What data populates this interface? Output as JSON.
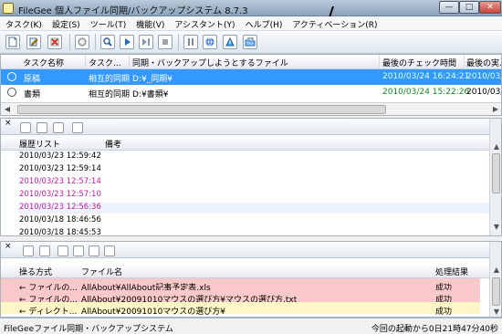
{
  "window": {
    "title": "FileGee 個人ファイル同期/バックアップシステム 8.7.3",
    "minimize": "—",
    "maximize": "□",
    "close": "✕"
  },
  "menu": [
    "タスク(K)",
    "設定(S)",
    "ツール(T)",
    "機能(V)",
    "アシスタント(Y)",
    "ヘルプ(H)",
    "アクティベーション(R)"
  ],
  "toolbar": {
    "icons": [
      "new-task-icon",
      "edit-task-icon",
      "delete-task-icon",
      "settings-icon",
      "search-icon",
      "run-icon",
      "step-icon",
      "stop-icon",
      "pause-icon",
      "web-icon",
      "update-icon",
      "folder-sync-icon"
    ]
  },
  "tasks": {
    "columns": [
      "タスク名称",
      "タスク...",
      "同期・バックアップしようとするファイル",
      "最後のチェック時間",
      "最後の実..."
    ],
    "rows": [
      {
        "name": "原稿",
        "type": "相互的同期",
        "path": "D:¥_同期¥",
        "checked": "2010/03/24 16:24:21",
        "last": "2010/03/"
      },
      {
        "name": "書類",
        "type": "相互的同期",
        "path": "D:¥書類¥",
        "checked": "2010/03/24 15:22:26",
        "last": "2010/03/"
      }
    ]
  },
  "history": {
    "columns": [
      "履歴リスト",
      "備考"
    ],
    "rows": [
      {
        "time": "2010/03/23 12:59:42",
        "color": "#000000"
      },
      {
        "time": "2010/03/23 12:59:14",
        "color": "#000000"
      },
      {
        "time": "2010/03/23 12:57:14",
        "color": "#c021a5"
      },
      {
        "time": "2010/03/23 12:57:10",
        "color": "#c021a5"
      },
      {
        "time": "2010/03/23 12:56:36",
        "color": "#c021a5"
      },
      {
        "time": "2010/03/18 18:46:56",
        "color": "#000000"
      },
      {
        "time": "2010/03/18 18:45:53",
        "color": "#000000"
      }
    ]
  },
  "operations": {
    "columns": [
      "操る方式",
      "ファイル名",
      "処理結果"
    ],
    "rows": [
      {
        "method": "← ファイルの...",
        "file": "AllAbout¥AllAbout記事予定表.xls",
        "result": "成功",
        "bg": "pink"
      },
      {
        "method": "← ファイルの...",
        "file": "AllAbout¥20091010マウスの選び方¥マウスの選び方.txt",
        "result": "成功",
        "bg": "pink"
      },
      {
        "method": "← ディレクト...",
        "file": "AllAbout¥20091010マウスの選び方¥",
        "result": "成功",
        "bg": "yellow"
      }
    ]
  },
  "status": {
    "left": "FileGeeファイル同期・バックアップシステム",
    "right": "今回の起動から0日21時47分40秒"
  }
}
